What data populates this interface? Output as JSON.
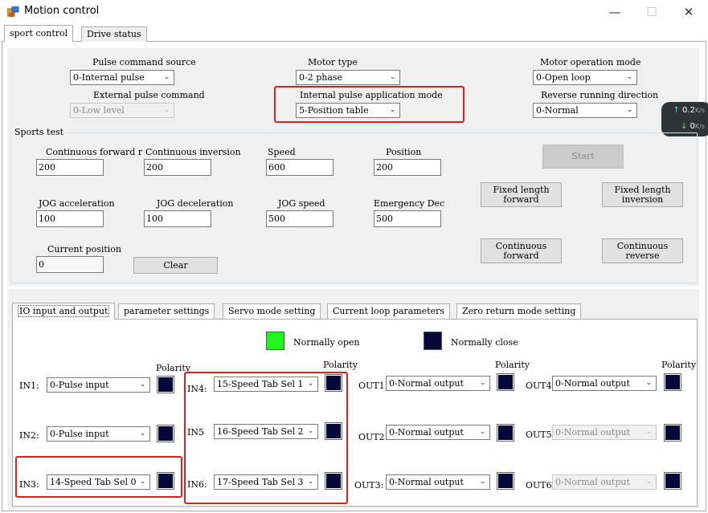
{
  "window": {
    "title": "Motion control",
    "minimize": "—",
    "maximize": "☐",
    "close": "✕"
  },
  "main_tabs": [
    "sport control",
    "Drive status"
  ],
  "config": {
    "pulse_command_source": {
      "label": "Pulse command source",
      "value": "0-Internal pulse"
    },
    "motor_type": {
      "label": "Motor type",
      "value": "0-2 phase"
    },
    "motor_operation_mode": {
      "label": "Motor operation mode",
      "value": "0-Open loop"
    },
    "external_pulse_command": {
      "label": "External pulse command",
      "value": "0-Low level"
    },
    "internal_pulse_mode": {
      "label": "Internal pulse application mode",
      "value": "5-Position table"
    },
    "reverse_running_direction": {
      "label": "Reverse running direction",
      "value": "0-Normal"
    }
  },
  "network": {
    "up": "0.2",
    "down": "0",
    "unit": "K/s"
  },
  "sports_test": {
    "title": "Sports test",
    "continuous_forward": {
      "label": "Continuous forward r",
      "value": "200"
    },
    "continuous_inversion": {
      "label": "Continuous inversion",
      "value": "200"
    },
    "speed": {
      "label": "Speed",
      "value": "600"
    },
    "position": {
      "label": "Position",
      "value": "200"
    },
    "jog_acceleration": {
      "label": "JOG acceleration",
      "value": "100"
    },
    "jog_deceleration": {
      "label": "JOG deceleration",
      "value": "100"
    },
    "jog_speed": {
      "label": "JOG speed",
      "value": "500"
    },
    "emergency_dec": {
      "label": "Emergency Dec",
      "value": "500"
    },
    "current_position": {
      "label": "Current position",
      "value": "0"
    },
    "clear": "Clear",
    "start": "Start",
    "fixed_length_forward": "Fixed length forward",
    "fixed_length_inversion": "Fixed length inversion",
    "continuous_forward_btn": "Continuous forward",
    "continuous_reverse_btn": "Continuous reverse"
  },
  "io_tabs": [
    "IO input and output",
    "parameter settings",
    "Servo mode setting",
    "Current loop parameters",
    "Zero return mode setting"
  ],
  "io": {
    "legend": {
      "normally_open": "Normally open",
      "normally_close": "Normally close",
      "open_color": "#22f522",
      "close_color": "#050838"
    },
    "polarity": "Polarity",
    "in1": {
      "label": "IN1:",
      "value": "0-Pulse input"
    },
    "in2": {
      "label": "IN2:",
      "value": "0-Pulse input"
    },
    "in3": {
      "label": "IN3:",
      "value": "14-Speed Tab Sel 0"
    },
    "in4": {
      "label": "IN4:",
      "value": "15-Speed Tab Sel 1"
    },
    "in5": {
      "label": "IN5",
      "value": "16-Speed Tab Sel 2"
    },
    "in6": {
      "label": "IN6:",
      "value": "17-Speed Tab Sel 3"
    },
    "out1": {
      "label": "OUT1:",
      "value": "0-Normal output"
    },
    "out2": {
      "label": "OUT2:",
      "value": "0-Normal output"
    },
    "out3": {
      "label": "OUT3:",
      "value": "0-Normal output"
    },
    "out4": {
      "label": "OUT4:",
      "value": "0-Normal output"
    },
    "out5": {
      "label": "OUT5:",
      "value": "0-Normal output"
    },
    "out6": {
      "label": "OUT6:",
      "value": "0-Normal output"
    }
  },
  "highlight_color": "#e02020"
}
